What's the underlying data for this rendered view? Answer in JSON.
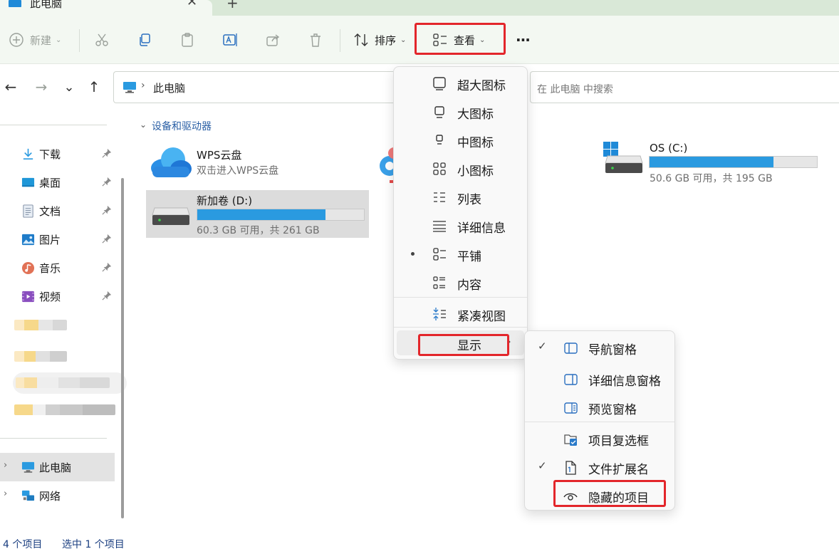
{
  "tab": {
    "title": "此电脑",
    "close": "✕",
    "new": "+"
  },
  "toolbar": {
    "new_label": "新建",
    "sort_label": "排序",
    "view_label": "查看",
    "more_label": "···"
  },
  "nav": {
    "back": "←",
    "forward": "→",
    "history": "⌄",
    "up": "↑"
  },
  "address": {
    "separator": "›",
    "text": "此电脑"
  },
  "search": {
    "placeholder": "在 此电脑 中搜索"
  },
  "sidebar": {
    "quick_access": [
      {
        "label": "下载",
        "icon": "download-icon"
      },
      {
        "label": "桌面",
        "icon": "desktop-icon"
      },
      {
        "label": "文档",
        "icon": "document-icon"
      },
      {
        "label": "图片",
        "icon": "pictures-icon"
      },
      {
        "label": "音乐",
        "icon": "music-icon"
      },
      {
        "label": "视频",
        "icon": "video-icon"
      }
    ],
    "this_pc": "此电脑",
    "network": "网络",
    "chevron": "›"
  },
  "content": {
    "section_title": "设备和驱动器",
    "wps": {
      "name": "WPS云盘",
      "sub": "双击进入WPS云盘"
    },
    "drive_d": {
      "name": "新加卷 (D:)",
      "sub": "60.3 GB 可用，共 261 GB",
      "used_fraction": 0.77
    },
    "drive_c": {
      "name": "OS (C:)",
      "sub": "50.6 GB 可用，共 195 GB",
      "used_fraction": 0.74
    }
  },
  "view_menu": {
    "items": [
      {
        "label": "超大图标",
        "icon": "extra-large-icons-icon"
      },
      {
        "label": "大图标",
        "icon": "large-icons-icon"
      },
      {
        "label": "中图标",
        "icon": "medium-icons-icon"
      },
      {
        "label": "小图标",
        "icon": "small-icons-icon"
      },
      {
        "label": "列表",
        "icon": "list-icon"
      },
      {
        "label": "详细信息",
        "icon": "details-icon"
      },
      {
        "label": "平铺",
        "icon": "tiles-icon"
      },
      {
        "label": "内容",
        "icon": "content-icon"
      },
      {
        "label": "紧凑视图",
        "icon": "compact-view-icon"
      },
      {
        "label": "显示",
        "icon": ""
      }
    ],
    "selected": "平铺",
    "submenu_chevron": "›"
  },
  "show_menu": {
    "items": [
      {
        "label": "导航窗格",
        "checked": true,
        "icon": "navigation-pane-icon"
      },
      {
        "label": "详细信息窗格",
        "checked": false,
        "icon": "details-pane-icon"
      },
      {
        "label": "预览窗格",
        "checked": false,
        "icon": "preview-pane-icon"
      },
      {
        "label": "项目复选框",
        "checked": false,
        "icon": "item-checkbox-icon"
      },
      {
        "label": "文件扩展名",
        "checked": true,
        "icon": "file-extension-icon"
      },
      {
        "label": "隐藏的项目",
        "checked": false,
        "icon": "hidden-items-icon"
      }
    ],
    "check": "✓"
  },
  "status": {
    "count": "4 个项目",
    "selected": "选中 1 个项目"
  },
  "colors": {
    "accent": "#2a9ae0",
    "highlight": "#e3262b",
    "link": "#2a5fa5"
  }
}
